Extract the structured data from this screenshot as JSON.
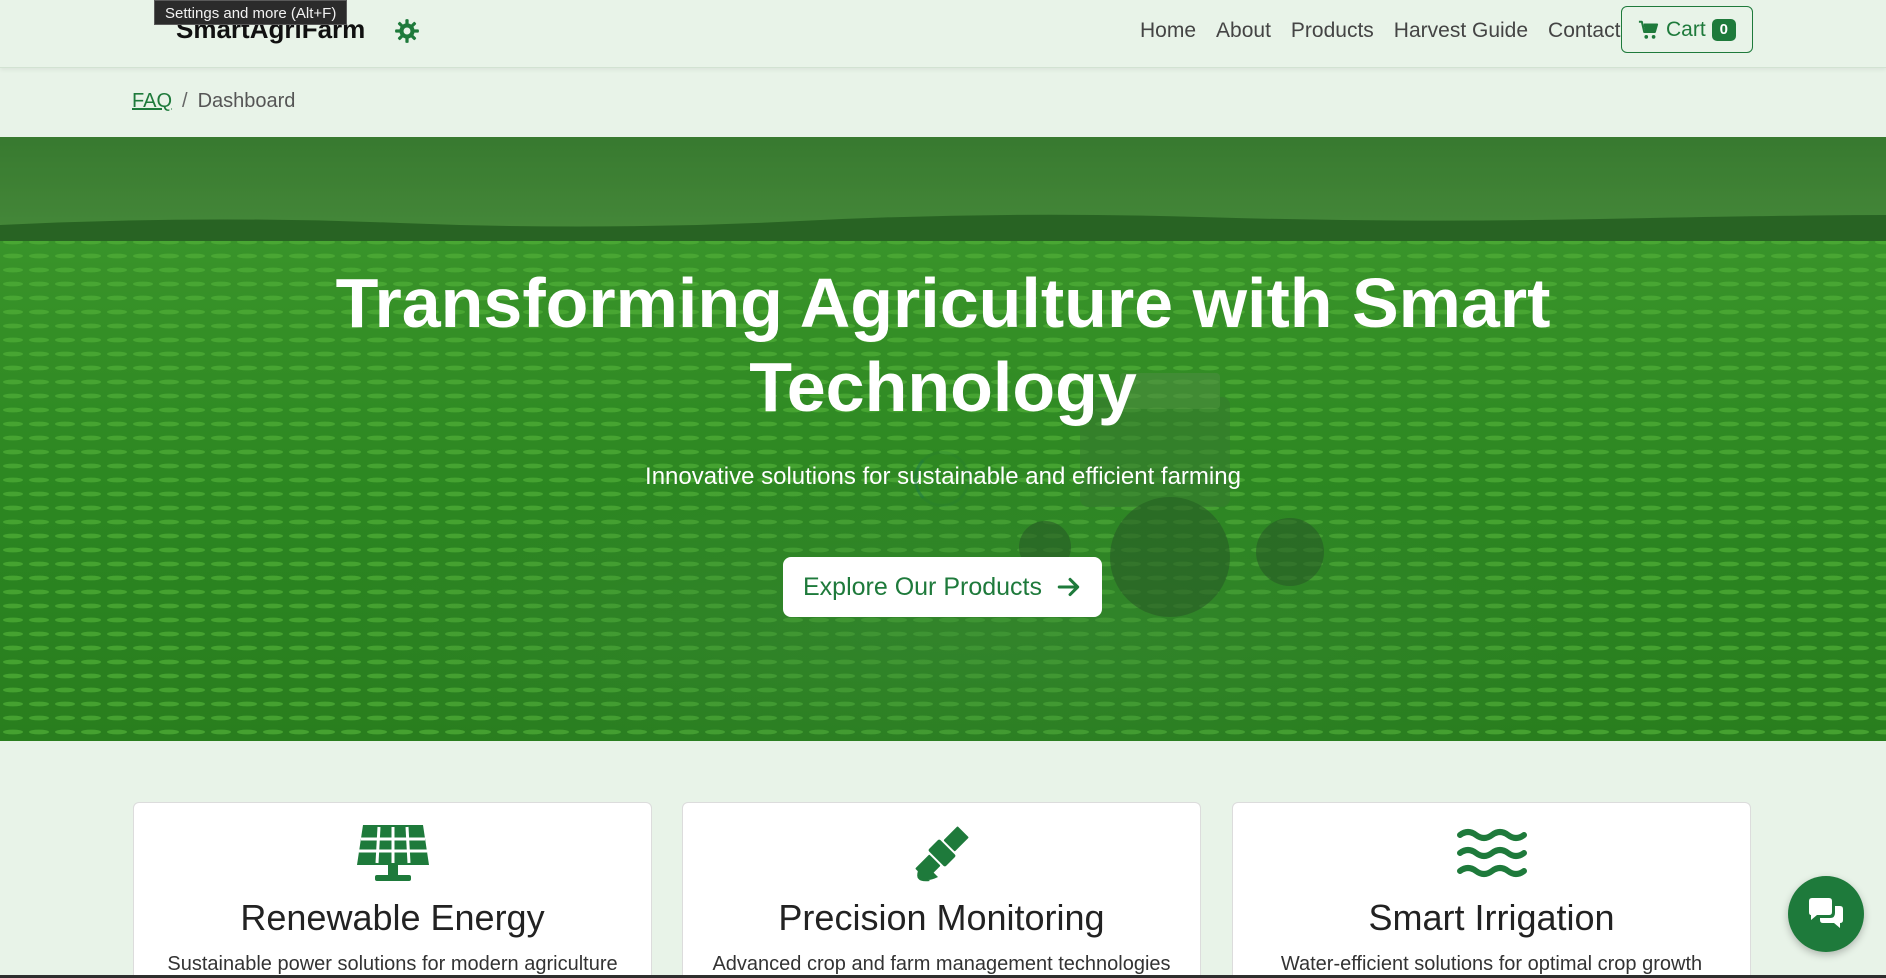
{
  "browser": {
    "tooltip": "Settings and more (Alt+F)"
  },
  "header": {
    "brand": "SmartAgriFarm",
    "nav": [
      {
        "label": "Home"
      },
      {
        "label": "About"
      },
      {
        "label": "Products"
      },
      {
        "label": "Harvest Guide"
      },
      {
        "label": "Contact"
      }
    ],
    "cart": {
      "label": "Cart",
      "count": "0",
      "icon": "cart-icon"
    },
    "theme_icon": "gear-icon"
  },
  "breadcrumb": {
    "link": "FAQ",
    "separator": "/",
    "current": "Dashboard"
  },
  "hero": {
    "title": "Transforming Agriculture with Smart Technology",
    "subtitle": "Innovative solutions for sustainable and efficient farming",
    "cta": {
      "label": "Explore Our Products",
      "icon": "arrow-right-icon"
    }
  },
  "features": [
    {
      "icon": "solar-panel-icon",
      "title": "Renewable Energy",
      "desc": "Sustainable power solutions for modern agriculture"
    },
    {
      "icon": "satellite-icon",
      "title": "Precision Monitoring",
      "desc": "Advanced crop and farm management technologies"
    },
    {
      "icon": "water-icon",
      "title": "Smart Irrigation",
      "desc": "Water-efficient solutions for optimal crop growth"
    }
  ],
  "chat": {
    "icon": "chat-icon"
  },
  "colors": {
    "primary": "#1e7a3b",
    "background": "#e8f3e8",
    "hero_overlay": "#2b7a1f"
  }
}
